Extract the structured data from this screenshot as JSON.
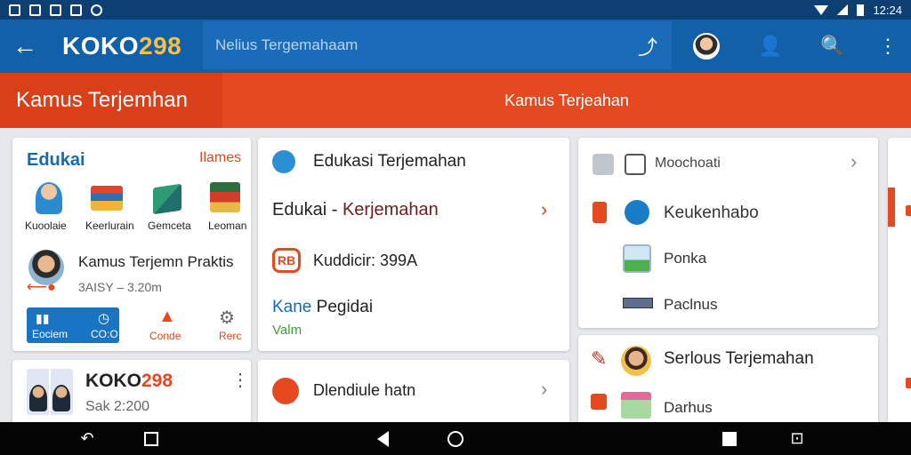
{
  "status_bar": {
    "time": "12:24"
  },
  "app_bar": {
    "title_prefix": "KOKO",
    "title_suffix": "298",
    "search_placeholder": "Nelius Tergemahaam"
  },
  "header": {
    "left_title": "Kamus Terjemhan",
    "center_title": "Kamus Terjeahan"
  },
  "card1": {
    "title": "Edukai",
    "link": "Ilames",
    "icons": [
      {
        "label": "Kuoolaie",
        "icon": "student-icon"
      },
      {
        "label": "Keerlurain",
        "icon": "books-icon"
      },
      {
        "label": "Gemceta",
        "icon": "cube-icon"
      },
      {
        "label": "Leoman",
        "icon": "stacked-books-icon"
      }
    ],
    "profile_title": "Kamus Terjemn Praktis",
    "profile_sub": "3AISY – 3.20m",
    "pill_label": "Eociem",
    "pill_value": "CO:O",
    "action1_label": "Conde",
    "action2_label": "Rerc"
  },
  "card2": {
    "row1_title": "Edukasi Terjemahan",
    "row2_title_a": "Edukai",
    "row2_sep": "-",
    "row2_title_b": "Kerjemahan",
    "row3_badge": "RB",
    "row3_title": "Kuddicir: 399A",
    "row4_title_a": "Kane",
    "row4_title_b": "Pegidai",
    "row4_sub": "Valm"
  },
  "card3": {
    "row1_label": "Moochoati",
    "row2_label": "Keukenhabo",
    "row3_label": "Ponka",
    "row4_label": "Paclnus"
  },
  "card4": {
    "title_prefix": "KOKO",
    "title_suffix": "298",
    "sub": "Sak 2:200"
  },
  "card5": {
    "title": "Dlendiule hatn"
  },
  "card6": {
    "row1_label": "Serlous Terjemahan",
    "row2_label": "Darhus"
  },
  "colors": {
    "primary": "#1160a8",
    "statusbar": "#0d3f73",
    "accent": "#e4491f",
    "link_red": "#d94b1f"
  }
}
